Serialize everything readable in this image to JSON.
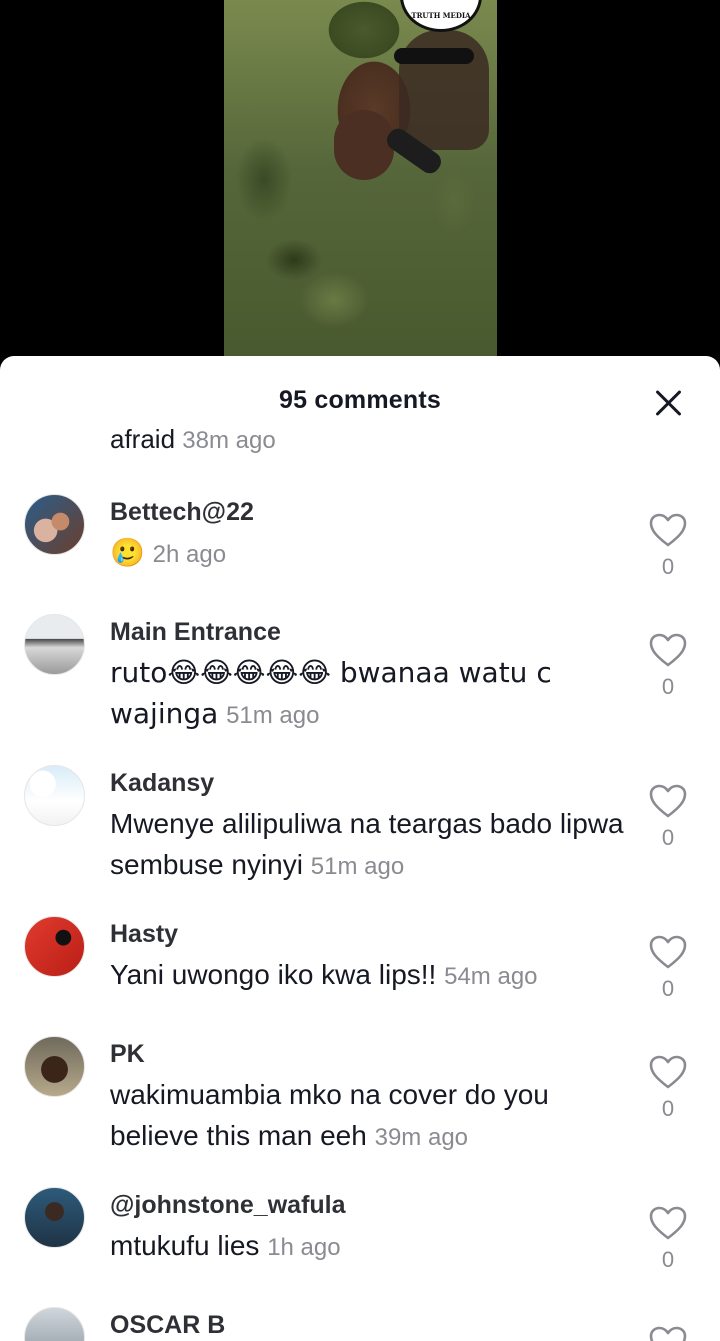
{
  "video": {
    "watermark": "TRUTH MEDIA"
  },
  "sheet": {
    "title": "95 comments"
  },
  "partial_comment": {
    "text": "afraid",
    "time": "38m ago"
  },
  "comments": [
    {
      "username": "Bettech@22",
      "text": "🥲",
      "time": "2h ago",
      "likes": "0"
    },
    {
      "username": "Main Entrance",
      "text": "ruto😂😂😂😂😂 bwanaa watu c wajinga",
      "time": "51m ago",
      "likes": "0"
    },
    {
      "username": "Kadansy",
      "text": "Mwenye alilipuliwa na teargas bado lipwa sembuse nyinyi",
      "time": "51m ago",
      "likes": "0"
    },
    {
      "username": "Hasty",
      "text": "Yani uwongo iko kwa lips!!",
      "time": "54m ago",
      "likes": "0"
    },
    {
      "username": "PK",
      "text": "wakimuambia mko na cover do you believe this man eeh",
      "time": "39m ago",
      "likes": "0"
    },
    {
      "username": "@johnstone_wafula",
      "text": "mtukufu lies",
      "time": "1h ago",
      "likes": "0"
    },
    {
      "username": "OSCAR B"
    }
  ]
}
